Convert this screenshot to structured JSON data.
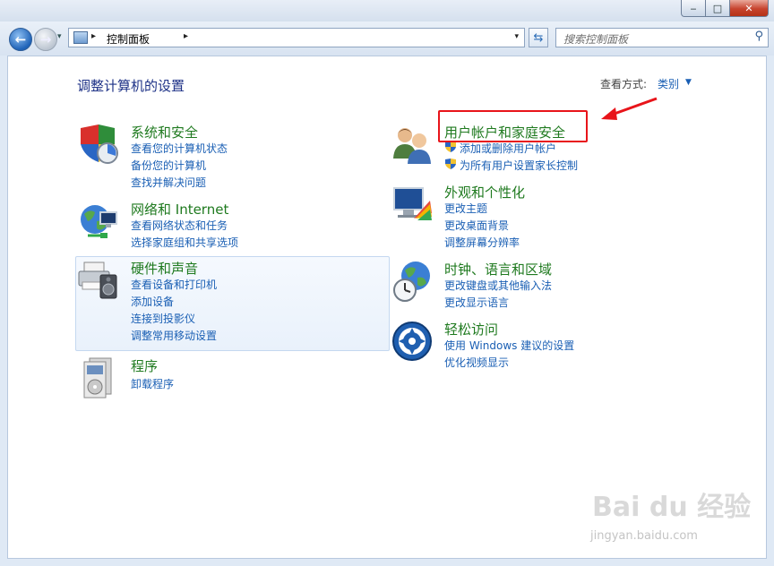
{
  "window": {
    "minimize_glyph": "‒",
    "maximize_glyph": "□",
    "close_glyph": "✕"
  },
  "navbar": {
    "back_glyph": "←",
    "forward_glyph": "→",
    "recent_glyph": "▾",
    "address": {
      "icon": "control-panel-icon",
      "separator": "▸",
      "path": "控制面板",
      "dropdown_glyph": "▾"
    },
    "refresh_glyph": "⇆",
    "search": {
      "placeholder": "搜索控制面板",
      "icon": "search-icon",
      "glyph": "⚲"
    }
  },
  "page": {
    "title": "调整计算机的设置",
    "view_by_label": "查看方式:",
    "view_by_value": "类别",
    "view_by_arrow": "▼"
  },
  "categories": [
    {
      "title": "系统和安全",
      "icon": "system-security-icon",
      "links": [
        "查看您的计算机状态",
        "备份您的计算机",
        "查找并解决问题"
      ]
    },
    {
      "title": "网络和 Internet",
      "icon": "network-internet-icon",
      "links": [
        "查看网络状态和任务",
        "选择家庭组和共享选项"
      ]
    },
    {
      "title": "硬件和声音",
      "icon": "hardware-sound-icon",
      "links": [
        "查看设备和打印机",
        "添加设备",
        "连接到投影仪",
        "调整常用移动设置"
      ]
    },
    {
      "title": "程序",
      "icon": "programs-icon",
      "links": [
        "卸载程序"
      ]
    },
    {
      "title": "用户帐户和家庭安全",
      "icon": "user-accounts-icon",
      "links": [
        "添加或删除用户帐户",
        "为所有用户设置家长控制"
      ]
    },
    {
      "title": "外观和个性化",
      "icon": "appearance-icon",
      "links": [
        "更改主题",
        "更改桌面背景",
        "调整屏幕分辨率"
      ]
    },
    {
      "title": "时钟、语言和区域",
      "icon": "clock-language-icon",
      "links": [
        "更改键盘或其他输入法",
        "更改显示语言"
      ]
    },
    {
      "title": "轻松访问",
      "icon": "ease-of-access-icon",
      "links": [
        "使用 Windows 建议的设置",
        "优化视频显示"
      ]
    }
  ],
  "annotation": {
    "highlight_color": "#e8141a"
  },
  "watermark": {
    "text": "Bai du 经验",
    "url": "jingyan.baidu.com"
  }
}
